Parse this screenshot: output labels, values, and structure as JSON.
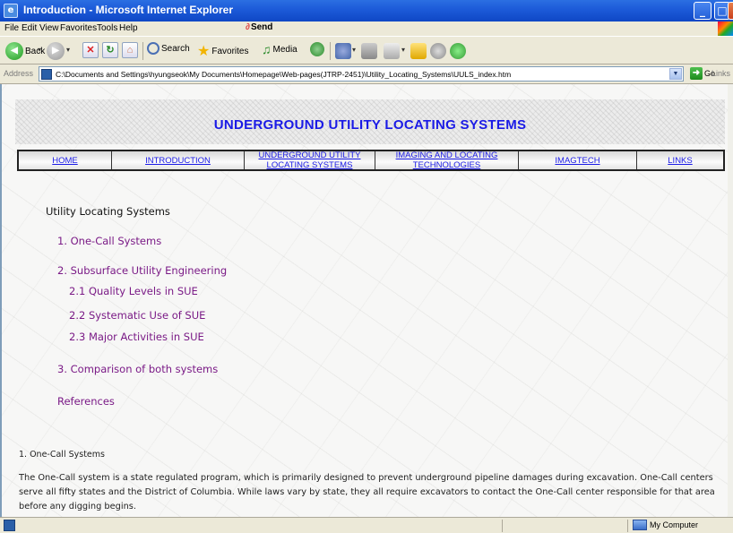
{
  "window": {
    "title": "Introduction - Microsoft Internet Explorer",
    "minimize": "_",
    "maximize": "□"
  },
  "menu": {
    "items": [
      "File",
      "Edit",
      "View",
      "Favorites",
      "Tools",
      "Help"
    ],
    "send_label": "Send"
  },
  "toolbar": {
    "back_label": "Back",
    "search_label": "Search",
    "favorites_label": "Favorites",
    "media_label": "Media"
  },
  "address": {
    "label": "Address",
    "url": "C:\\Documents and Settings\\hyungseok\\My Documents\\Homepage\\Web-pages(JTRP-2451)\\Utility_Locating_Systems\\UULS_index.htm",
    "go_label": "Go",
    "links_label": "Links"
  },
  "page": {
    "banner_title": "UNDERGROUND UTILITY LOCATING SYSTEMS",
    "nav": [
      {
        "line1": "HOME",
        "line2": ""
      },
      {
        "line1": "INTRODUCTION",
        "line2": ""
      },
      {
        "line1": "UNDERGROUND UTILITY",
        "line2": "LOCATING SYSTEMS"
      },
      {
        "line1": "IMAGING AND LOCATING",
        "line2": "TECHNOLOGIES"
      },
      {
        "line1": "IMAGTECH",
        "line2": ""
      },
      {
        "line1": "LINKS",
        "line2": ""
      }
    ],
    "toc_heading": "Utility Locating Systems",
    "toc": [
      "1. One-Call Systems",
      "2. Subsurface Utility Engineering",
      "2.1 Quality Levels in SUE",
      "2.2 Systematic Use of SUE",
      "2.3 Major Activities in SUE",
      "3. Comparison of both systems",
      "References"
    ],
    "section_title": "1. One-Call Systems",
    "section_body": "The One-Call system is a state regulated program, which is primarily designed to prevent underground pipeline damages during excavation. One-Call centers serve all fifty states and the District of Columbia. While laws vary by state, they all require excavators to contact the One-Call center responsible for that area before any digging begins."
  },
  "status": {
    "zone": "My Computer"
  },
  "colors": {
    "link": "#1a1ae6",
    "visited": "#7a1a86",
    "titlebar": "#1c5ad8"
  }
}
